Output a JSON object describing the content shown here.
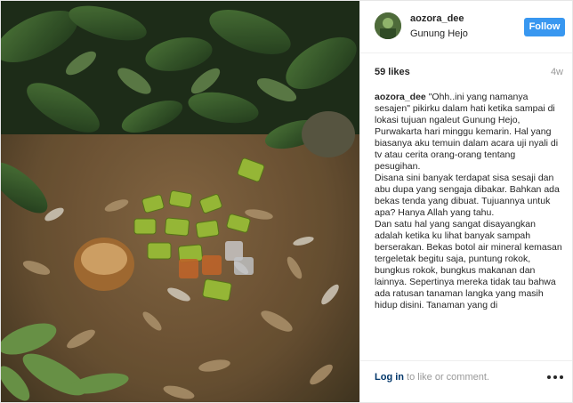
{
  "post": {
    "username": "aozora_dee",
    "location": "Gunung Hejo",
    "follow_label": "Follow",
    "likes": "59 likes",
    "age": "4w",
    "caption_user": "aozora_dee",
    "caption_text": " \"Ohh..ini yang namanya sesajen\" pikirku dalam hati ketika sampai di lokasi tujuan ngaleut Gunung Hejo, Purwakarta hari minggu kemarin. Hal yang biasanya aku temuin dalam acara uji nyali di tv atau cerita orang-orang tentang pesugihan.\nDisana sini banyak terdapat sisa sesaji dan abu dupa yang sengaja dibakar. Bahkan ada bekas tenda yang dibuat. Tujuannya untuk apa? Hanya Allah yang tahu.\nDan satu hal yang sangat disayangkan adalah ketika ku lihat banyak sampah berserakan. Bekas botol air mineral kemasan tergeletak begitu saja, puntung rokok, bungkus rokok, bungkus makanan dan lainnya. Sepertinya mereka tidak tau bahwa ada ratusan tanaman langka yang masih hidup disini. Tanaman yang di"
  },
  "footer": {
    "login_link": "Log in",
    "login_suffix": " to like or comment."
  },
  "colors": {
    "follow_button": "#3897f0",
    "link": "#003569",
    "muted": "#999999"
  },
  "icons": {
    "more": "more-options-icon"
  }
}
